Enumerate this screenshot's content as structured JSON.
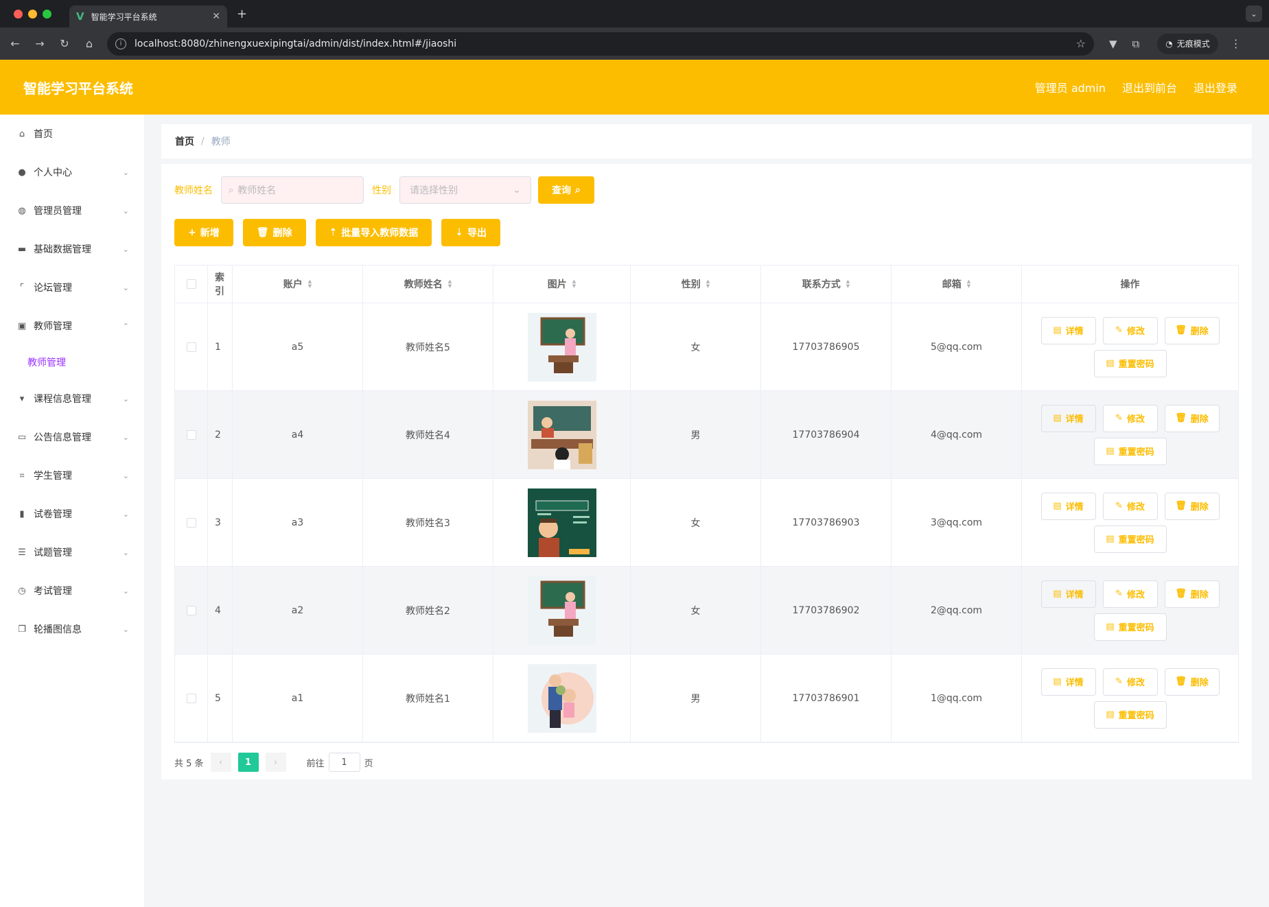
{
  "browser": {
    "tab_title": "智能学习平台系统",
    "url": "localhost:8080/zhinengxuexipingtai/admin/dist/index.html#/jiaoshi",
    "incognito_label": "无痕模式"
  },
  "header": {
    "brand": "智能学习平台系统",
    "admin_label": "管理员 admin",
    "to_front": "退出到前台",
    "logout": "退出登录"
  },
  "sidebar": {
    "items": [
      {
        "label": "首页",
        "icon": "home-icon"
      },
      {
        "label": "个人中心",
        "icon": "user-icon"
      },
      {
        "label": "管理员管理",
        "icon": "bulb-icon"
      },
      {
        "label": "基础数据管理",
        "icon": "ticket-icon"
      },
      {
        "label": "论坛管理",
        "icon": "frame-icon"
      },
      {
        "label": "教师管理",
        "icon": "clipboard-icon"
      },
      {
        "label": "课程信息管理",
        "icon": "podium-icon"
      },
      {
        "label": "公告信息管理",
        "icon": "card-icon"
      },
      {
        "label": "学生管理",
        "icon": "crop-icon"
      },
      {
        "label": "试卷管理",
        "icon": "bar-chart-icon"
      },
      {
        "label": "试题管理",
        "icon": "list-icon"
      },
      {
        "label": "考试管理",
        "icon": "compass-icon"
      },
      {
        "label": "轮播图信息",
        "icon": "copy-icon"
      }
    ],
    "active_sub": "教师管理"
  },
  "breadcrumb": {
    "home": "首页",
    "current": "教师"
  },
  "search": {
    "name_label": "教师姓名",
    "name_placeholder": "教师姓名",
    "sex_label": "性别",
    "sex_placeholder": "请选择性别",
    "query_button": "查询"
  },
  "actions": {
    "add": "新增",
    "delete": "删除",
    "import": "批量导入教师数据",
    "export": "导出"
  },
  "table": {
    "headers": {
      "index": "索引",
      "account": "账户",
      "name": "教师姓名",
      "image": "图片",
      "sex": "性别",
      "phone": "联系方式",
      "email": "邮箱",
      "ops": "操作"
    },
    "rows": [
      {
        "index": "1",
        "account": "a5",
        "name": "教师姓名5",
        "sex": "女",
        "phone": "17703786905",
        "email": "5@qq.com"
      },
      {
        "index": "2",
        "account": "a4",
        "name": "教师姓名4",
        "sex": "男",
        "phone": "17703786904",
        "email": "4@qq.com"
      },
      {
        "index": "3",
        "account": "a3",
        "name": "教师姓名3",
        "sex": "女",
        "phone": "17703786903",
        "email": "3@qq.com"
      },
      {
        "index": "4",
        "account": "a2",
        "name": "教师姓名2",
        "sex": "女",
        "phone": "17703786902",
        "email": "2@qq.com"
      },
      {
        "index": "5",
        "account": "a1",
        "name": "教师姓名1",
        "sex": "男",
        "phone": "17703786901",
        "email": "1@qq.com"
      }
    ],
    "op_labels": {
      "detail": "详情",
      "edit": "修改",
      "delete": "删除",
      "reset": "重置密码"
    }
  },
  "pagination": {
    "total": "共 5 条",
    "current_page": "1",
    "goto_label": "前往",
    "goto_value": "1",
    "page_suffix": "页"
  },
  "colors": {
    "accent": "#fcbd00",
    "page_active": "#20c997",
    "sub_active": "#9b30ff"
  }
}
